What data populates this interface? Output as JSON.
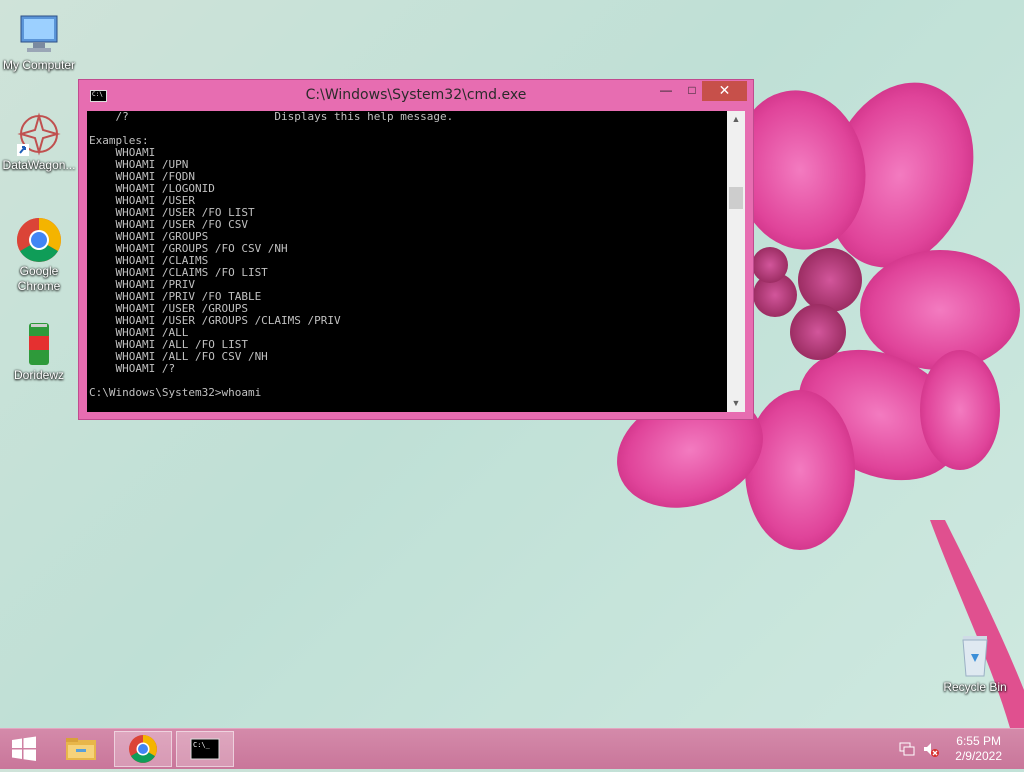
{
  "desktop": {
    "icons": [
      {
        "label": "My Computer",
        "icon": "computer-icon"
      },
      {
        "label": "DataWagon...",
        "icon": "datawagon-shortcut-icon"
      },
      {
        "label": "Google Chrome",
        "icon": "chrome-icon"
      },
      {
        "label": "Doridewz",
        "icon": "soda-can-icon"
      },
      {
        "label": "Recycle Bin",
        "icon": "recycle-bin-icon"
      }
    ]
  },
  "window": {
    "title": "C:\\Windows\\System32\\cmd.exe",
    "close_glyph": "✕",
    "min_glyph": "—",
    "max_glyph": "□",
    "console_text": "    /?                      Displays this help message.\n\nExamples:\n    WHOAMI\n    WHOAMI /UPN\n    WHOAMI /FQDN\n    WHOAMI /LOGONID\n    WHOAMI /USER\n    WHOAMI /USER /FO LIST\n    WHOAMI /USER /FO CSV\n    WHOAMI /GROUPS\n    WHOAMI /GROUPS /FO CSV /NH\n    WHOAMI /CLAIMS\n    WHOAMI /CLAIMS /FO LIST\n    WHOAMI /PRIV\n    WHOAMI /PRIV /FO TABLE\n    WHOAMI /USER /GROUPS\n    WHOAMI /USER /GROUPS /CLAIMS /PRIV\n    WHOAMI /ALL\n    WHOAMI /ALL /FO LIST\n    WHOAMI /ALL /FO CSV /NH\n    WHOAMI /?\n\nC:\\Windows\\System32>whoami",
    "colors": {
      "frame": "#e76db1",
      "close": "#c7504a"
    }
  },
  "taskbar": {
    "apps": [
      {
        "name": "file-explorer",
        "icon": "folder-icon"
      },
      {
        "name": "chrome",
        "icon": "chrome-icon"
      },
      {
        "name": "cmd",
        "icon": "cmd-icon"
      }
    ],
    "clock_time": "6:55 PM",
    "clock_date": "2/9/2022"
  }
}
